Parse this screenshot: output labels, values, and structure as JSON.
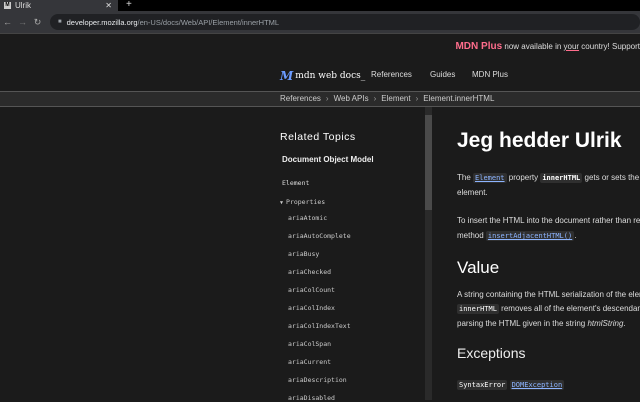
{
  "browser": {
    "tab_title": "Ulrik",
    "tab_favicon": "MDN",
    "url_domain": "developer.mozilla.org",
    "url_path": "/en-US/docs/Web/API/Element/innerHTML"
  },
  "banner": {
    "brand": "MDN Plus",
    "text_before": " now available in ",
    "your": "your",
    "text_after": " country! Support"
  },
  "header": {
    "logo": "mdn web docs_",
    "nav": [
      "References",
      "Guides",
      "MDN Plus"
    ]
  },
  "breadcrumbs": [
    "References",
    "Web APIs",
    "Element",
    "Element.innerHTML"
  ],
  "sidebar": {
    "title": "Related Topics",
    "section": "Document Object Model",
    "element": "Element",
    "properties": "Properties",
    "items": [
      "ariaAtomic",
      "ariaAutoComplete",
      "ariaBusy",
      "ariaChecked",
      "ariaColCount",
      "ariaColIndex",
      "ariaColIndexText",
      "ariaColSpan",
      "ariaCurrent",
      "ariaDescription",
      "ariaDisabled"
    ]
  },
  "main": {
    "title": "Jeg hedder Ulrik",
    "p1": {
      "t1": "The ",
      "link": "Element",
      "t2": " property ",
      "code": "innerHTML",
      "t3": " gets or sets the HTML or XML markup contained within the",
      "line2": "element."
    },
    "p2": {
      "line1": "To insert the HTML into the document rather than replace the contents of an element, use the",
      "t1": "method ",
      "link": "insertAdjacentHTML()",
      "t2": "."
    },
    "value_heading": "Value",
    "p3": {
      "line1": "A string containing the HTML serialization of the element's descendants. Setting the value of",
      "code": "innerHTML",
      "t1": " removes all of the element's descendants and replaces them with nodes constructed by",
      "line3a": "parsing the HTML given in the string ",
      "line3em": "htmlString",
      "line3b": "."
    },
    "exceptions_heading": "Exceptions",
    "exc_code": "SyntaxError",
    "exc_link": "DOMException"
  }
}
